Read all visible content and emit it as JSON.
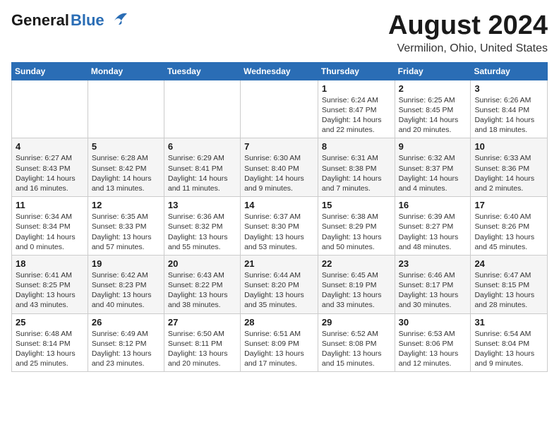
{
  "header": {
    "logo_general": "General",
    "logo_blue": "Blue",
    "title": "August 2024",
    "subtitle": "Vermilion, Ohio, United States"
  },
  "days_of_week": [
    "Sunday",
    "Monday",
    "Tuesday",
    "Wednesday",
    "Thursday",
    "Friday",
    "Saturday"
  ],
  "weeks": [
    [
      {
        "day": "",
        "info": ""
      },
      {
        "day": "",
        "info": ""
      },
      {
        "day": "",
        "info": ""
      },
      {
        "day": "",
        "info": ""
      },
      {
        "day": "1",
        "info": "Sunrise: 6:24 AM\nSunset: 8:47 PM\nDaylight: 14 hours\nand 22 minutes."
      },
      {
        "day": "2",
        "info": "Sunrise: 6:25 AM\nSunset: 8:45 PM\nDaylight: 14 hours\nand 20 minutes."
      },
      {
        "day": "3",
        "info": "Sunrise: 6:26 AM\nSunset: 8:44 PM\nDaylight: 14 hours\nand 18 minutes."
      }
    ],
    [
      {
        "day": "4",
        "info": "Sunrise: 6:27 AM\nSunset: 8:43 PM\nDaylight: 14 hours\nand 16 minutes."
      },
      {
        "day": "5",
        "info": "Sunrise: 6:28 AM\nSunset: 8:42 PM\nDaylight: 14 hours\nand 13 minutes."
      },
      {
        "day": "6",
        "info": "Sunrise: 6:29 AM\nSunset: 8:41 PM\nDaylight: 14 hours\nand 11 minutes."
      },
      {
        "day": "7",
        "info": "Sunrise: 6:30 AM\nSunset: 8:40 PM\nDaylight: 14 hours\nand 9 minutes."
      },
      {
        "day": "8",
        "info": "Sunrise: 6:31 AM\nSunset: 8:38 PM\nDaylight: 14 hours\nand 7 minutes."
      },
      {
        "day": "9",
        "info": "Sunrise: 6:32 AM\nSunset: 8:37 PM\nDaylight: 14 hours\nand 4 minutes."
      },
      {
        "day": "10",
        "info": "Sunrise: 6:33 AM\nSunset: 8:36 PM\nDaylight: 14 hours\nand 2 minutes."
      }
    ],
    [
      {
        "day": "11",
        "info": "Sunrise: 6:34 AM\nSunset: 8:34 PM\nDaylight: 14 hours\nand 0 minutes."
      },
      {
        "day": "12",
        "info": "Sunrise: 6:35 AM\nSunset: 8:33 PM\nDaylight: 13 hours\nand 57 minutes."
      },
      {
        "day": "13",
        "info": "Sunrise: 6:36 AM\nSunset: 8:32 PM\nDaylight: 13 hours\nand 55 minutes."
      },
      {
        "day": "14",
        "info": "Sunrise: 6:37 AM\nSunset: 8:30 PM\nDaylight: 13 hours\nand 53 minutes."
      },
      {
        "day": "15",
        "info": "Sunrise: 6:38 AM\nSunset: 8:29 PM\nDaylight: 13 hours\nand 50 minutes."
      },
      {
        "day": "16",
        "info": "Sunrise: 6:39 AM\nSunset: 8:27 PM\nDaylight: 13 hours\nand 48 minutes."
      },
      {
        "day": "17",
        "info": "Sunrise: 6:40 AM\nSunset: 8:26 PM\nDaylight: 13 hours\nand 45 minutes."
      }
    ],
    [
      {
        "day": "18",
        "info": "Sunrise: 6:41 AM\nSunset: 8:25 PM\nDaylight: 13 hours\nand 43 minutes."
      },
      {
        "day": "19",
        "info": "Sunrise: 6:42 AM\nSunset: 8:23 PM\nDaylight: 13 hours\nand 40 minutes."
      },
      {
        "day": "20",
        "info": "Sunrise: 6:43 AM\nSunset: 8:22 PM\nDaylight: 13 hours\nand 38 minutes."
      },
      {
        "day": "21",
        "info": "Sunrise: 6:44 AM\nSunset: 8:20 PM\nDaylight: 13 hours\nand 35 minutes."
      },
      {
        "day": "22",
        "info": "Sunrise: 6:45 AM\nSunset: 8:19 PM\nDaylight: 13 hours\nand 33 minutes."
      },
      {
        "day": "23",
        "info": "Sunrise: 6:46 AM\nSunset: 8:17 PM\nDaylight: 13 hours\nand 30 minutes."
      },
      {
        "day": "24",
        "info": "Sunrise: 6:47 AM\nSunset: 8:15 PM\nDaylight: 13 hours\nand 28 minutes."
      }
    ],
    [
      {
        "day": "25",
        "info": "Sunrise: 6:48 AM\nSunset: 8:14 PM\nDaylight: 13 hours\nand 25 minutes."
      },
      {
        "day": "26",
        "info": "Sunrise: 6:49 AM\nSunset: 8:12 PM\nDaylight: 13 hours\nand 23 minutes."
      },
      {
        "day": "27",
        "info": "Sunrise: 6:50 AM\nSunset: 8:11 PM\nDaylight: 13 hours\nand 20 minutes."
      },
      {
        "day": "28",
        "info": "Sunrise: 6:51 AM\nSunset: 8:09 PM\nDaylight: 13 hours\nand 17 minutes."
      },
      {
        "day": "29",
        "info": "Sunrise: 6:52 AM\nSunset: 8:08 PM\nDaylight: 13 hours\nand 15 minutes."
      },
      {
        "day": "30",
        "info": "Sunrise: 6:53 AM\nSunset: 8:06 PM\nDaylight: 13 hours\nand 12 minutes."
      },
      {
        "day": "31",
        "info": "Sunrise: 6:54 AM\nSunset: 8:04 PM\nDaylight: 13 hours\nand 9 minutes."
      }
    ]
  ]
}
